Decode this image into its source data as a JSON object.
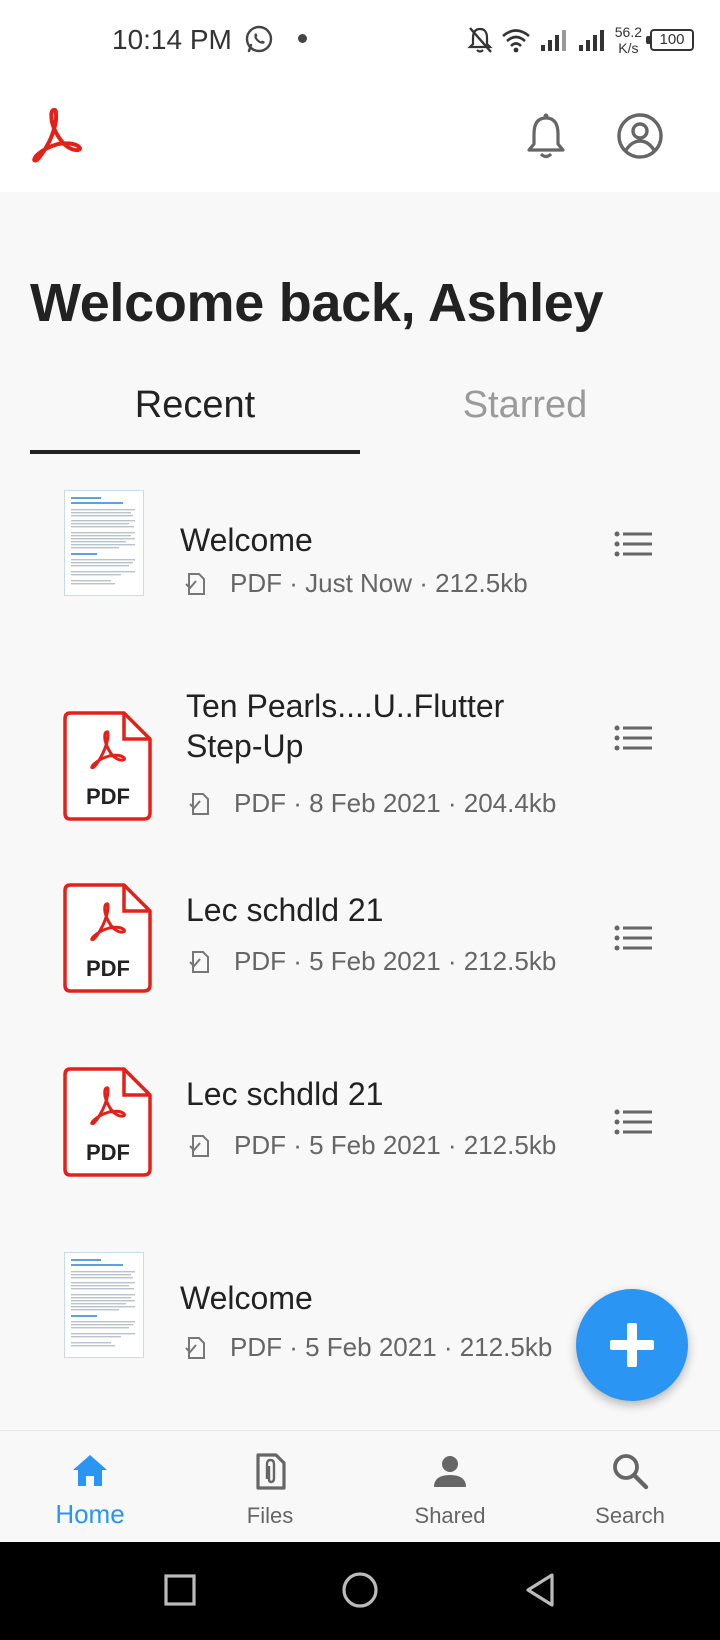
{
  "status_bar": {
    "time": "10:14 PM",
    "speed": "56.2",
    "speed_unit": "K/s",
    "battery": "100"
  },
  "header": {
    "greeting": "Welcome back, Ashley"
  },
  "tabs": [
    {
      "label": "Recent",
      "active": true
    },
    {
      "label": "Starred",
      "active": false
    }
  ],
  "files": [
    {
      "name": "Welcome",
      "meta": "PDF · Just Now · 212.5kb",
      "thumbnail": "document-preview"
    },
    {
      "name": "Ten Pearls....U..Flutter Step-Up",
      "meta": "PDF · 8 Feb 2021 · 204.4kb",
      "thumbnail": "pdf-icon"
    },
    {
      "name": "Lec schdld 21",
      "meta": "PDF · 5 Feb 2021 · 212.5kb",
      "thumbnail": "pdf-icon"
    },
    {
      "name": "Lec schdld 21",
      "meta": "PDF · 5 Feb 2021 · 212.5kb",
      "thumbnail": "pdf-icon"
    },
    {
      "name": "Welcome",
      "meta": "PDF · 5 Feb 2021 · 212.5kb",
      "thumbnail": "document-preview"
    }
  ],
  "pdf_badge": "PDF",
  "bottom_nav": [
    {
      "label": "Home",
      "icon": "home-icon",
      "active": true
    },
    {
      "label": "Files",
      "icon": "files-icon",
      "active": false
    },
    {
      "label": "Shared",
      "icon": "person-icon",
      "active": false
    },
    {
      "label": "Search",
      "icon": "search-icon",
      "active": false
    }
  ],
  "colors": {
    "accent": "#2b95f3",
    "brand_red": "#e32119",
    "background": "#f8f8f8"
  }
}
